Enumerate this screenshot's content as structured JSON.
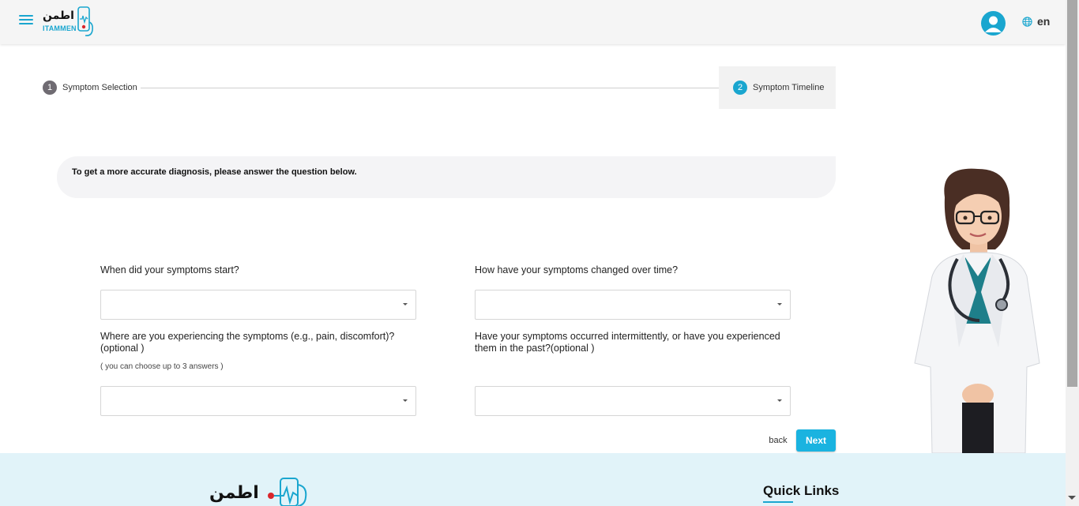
{
  "header": {
    "logo_ar": "اطمن",
    "logo_en": "ITAMMEN",
    "language": "en"
  },
  "stepper": {
    "steps": [
      {
        "number": "1",
        "label": "Symptom Selection"
      },
      {
        "number": "2",
        "label": "Symptom Timeline"
      }
    ]
  },
  "banner": {
    "text": "To get a more accurate diagnosis, please answer the question below."
  },
  "questions": {
    "start": {
      "label": "When did your symptoms start?",
      "value": ""
    },
    "changed": {
      "label": "How have your symptoms changed over time?",
      "value": ""
    },
    "location": {
      "label": "Where are you experiencing the symptoms (e.g., pain, discomfort)?(optional )",
      "hint": "( you can choose up to 3 answers )",
      "value": ""
    },
    "intermittent": {
      "label": "Have your symptoms occurred intermittently, or have you experienced them in the past?(optional )",
      "value": ""
    }
  },
  "actions": {
    "back_label": "back",
    "next_label": "Next"
  },
  "footer": {
    "logo_ar": "اطمن",
    "quick_links_title": "Quick Links"
  },
  "colors": {
    "accent": "#1aa6cf",
    "button": "#1ab3e0",
    "footer_bg": "#e1f3f9"
  }
}
